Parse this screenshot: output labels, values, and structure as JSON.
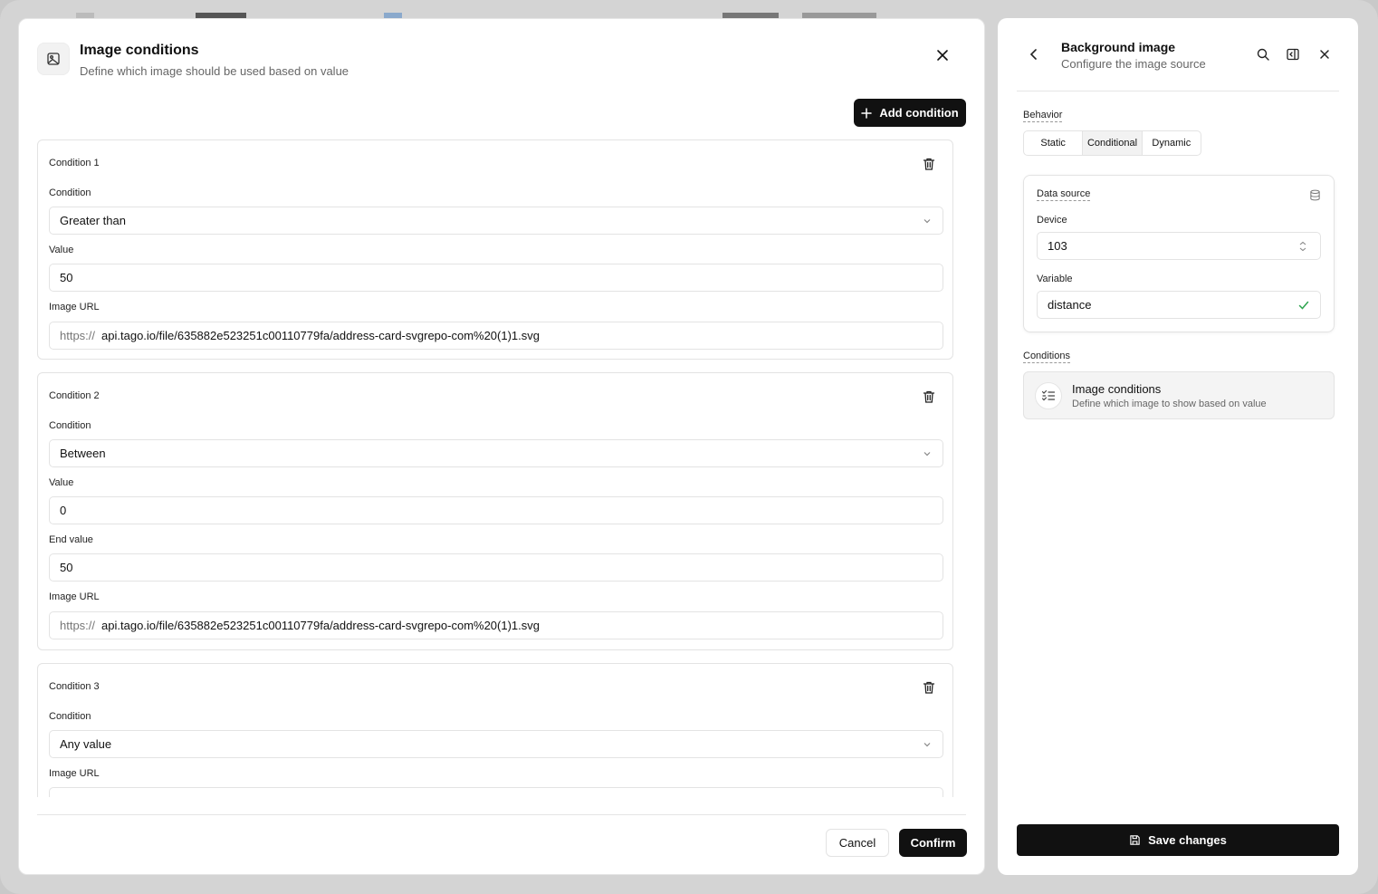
{
  "modal": {
    "title": "Image conditions",
    "subtitle": "Define which image should be used based on value",
    "add_label": "Add condition",
    "conditions": [
      {
        "title": "Condition 1",
        "condition_label": "Condition",
        "condition_value": "Greater than",
        "value_label": "Value",
        "value": "50",
        "url_label": "Image URL",
        "url_prefix": "https://",
        "url": "api.tago.io/file/635882e523251c00110779fa/address-card-svgrepo-com%20(1)1.svg"
      },
      {
        "title": "Condition 2",
        "condition_label": "Condition",
        "condition_value": "Between",
        "value_label": "Value",
        "value": "0",
        "end_label": "End value",
        "end_value": "50",
        "url_label": "Image URL",
        "url_prefix": "https://",
        "url": "api.tago.io/file/635882e523251c00110779fa/address-card-svgrepo-com%20(1)1.svg"
      },
      {
        "title": "Condition 3",
        "condition_label": "Condition",
        "condition_value": "Any value",
        "url_label": "Image URL"
      }
    ],
    "cancel_label": "Cancel",
    "confirm_label": "Confirm"
  },
  "panel": {
    "title": "Background image",
    "subtitle": "Configure the image source",
    "behavior_label": "Behavior",
    "behavior_options": [
      "Static",
      "Conditional",
      "Dynamic"
    ],
    "behavior_selected": "Conditional",
    "data_source_label": "Data source",
    "device_label": "Device",
    "device_value": "103",
    "variable_label": "Variable",
    "variable_value": "distance",
    "conditions_label": "Conditions",
    "conditions_card_title": "Image conditions",
    "conditions_card_subtitle": "Define which image to show based on value",
    "save_label": "Save changes"
  },
  "colors": {
    "primary": "#111111",
    "border": "#e3e3e3",
    "success": "#2ea44f",
    "muted": "#666666"
  }
}
